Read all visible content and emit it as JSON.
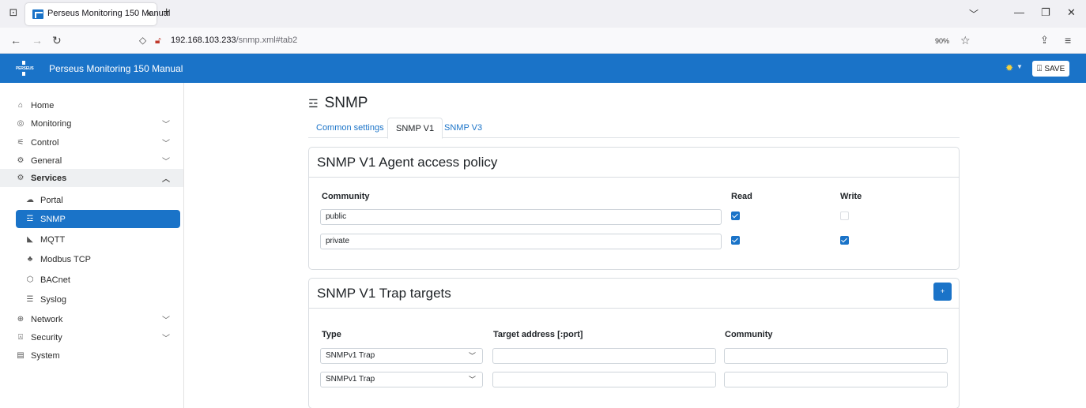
{
  "browser": {
    "tab_title": "Perseus Monitoring 150 Manual",
    "tab_close": "×",
    "new_tab": "+",
    "url_host": "192.168.103.233",
    "url_path": "/snmp.xml#tab2",
    "zoom": "90%"
  },
  "app": {
    "logo_text": "PERSEUS",
    "title": "Perseus Monitoring 150 Manual",
    "save_label": "SAVE"
  },
  "sidebar": {
    "items": [
      {
        "label": "Home",
        "icon": "home-icon"
      },
      {
        "label": "Monitoring",
        "icon": "gauge-icon"
      },
      {
        "label": "Control",
        "icon": "control-icon"
      },
      {
        "label": "General",
        "icon": "gear-icon"
      },
      {
        "label": "Services",
        "icon": "services-icon"
      },
      {
        "label": "Portal",
        "icon": "cloud-icon"
      },
      {
        "label": "SNMP",
        "icon": "snmp-icon"
      },
      {
        "label": "MQTT",
        "icon": "wifi-icon"
      },
      {
        "label": "Modbus TCP",
        "icon": "network-tree-icon"
      },
      {
        "label": "BACnet",
        "icon": "hexagon-icon"
      },
      {
        "label": "Syslog",
        "icon": "list-icon"
      },
      {
        "label": "Network",
        "icon": "globe-icon"
      },
      {
        "label": "Security",
        "icon": "lock-icon"
      },
      {
        "label": "System",
        "icon": "system-icon"
      }
    ]
  },
  "main": {
    "page_title": "SNMP",
    "tabs": [
      "Common settings",
      "SNMP V1",
      "SNMP V3"
    ],
    "access_card": {
      "title": "SNMP V1 Agent access policy",
      "headers": {
        "community": "Community",
        "read": "Read",
        "write": "Write"
      },
      "rows": [
        {
          "community": "public",
          "read": true,
          "write": false
        },
        {
          "community": "private",
          "read": true,
          "write": true
        }
      ]
    },
    "trap_card": {
      "title": "SNMP V1 Trap targets",
      "add_label": "+",
      "headers": {
        "type": "Type",
        "target": "Target address [:port]",
        "community": "Community"
      },
      "rows": [
        {
          "type": "SNMPv1 Trap",
          "target": "",
          "community": ""
        },
        {
          "type": "SNMPv1 Trap",
          "target": "",
          "community": ""
        }
      ]
    }
  }
}
